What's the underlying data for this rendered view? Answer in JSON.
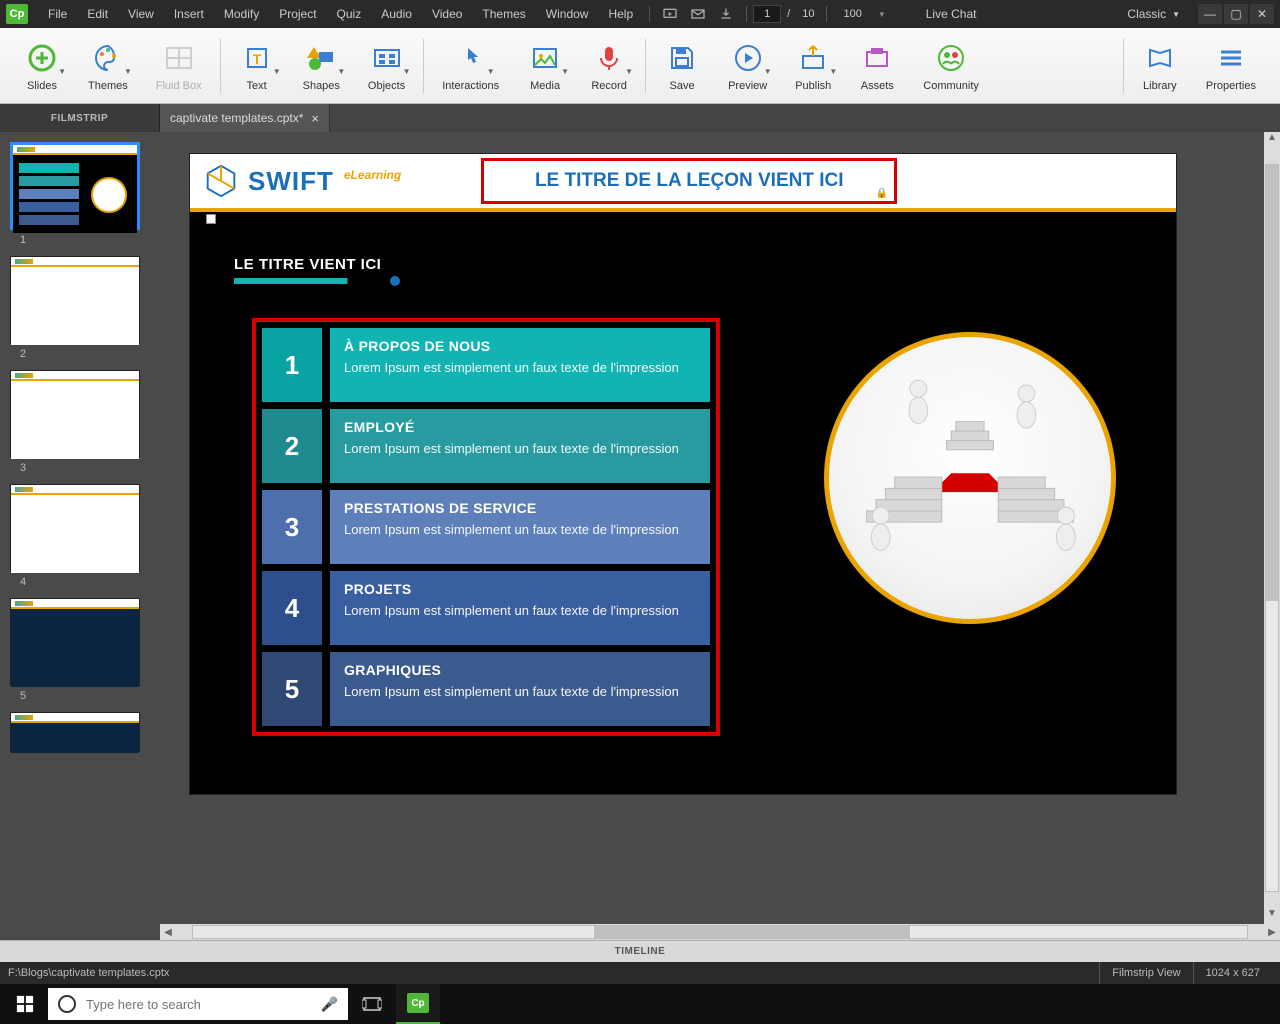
{
  "titlebar": {
    "menus": [
      "File",
      "Edit",
      "View",
      "Insert",
      "Modify",
      "Project",
      "Quiz",
      "Audio",
      "Video",
      "Themes",
      "Window",
      "Help"
    ],
    "page_current": "1",
    "page_total": "10",
    "zoom": "100",
    "live_chat": "Live Chat",
    "workspace": "Classic"
  },
  "ribbon": {
    "slides": "Slides",
    "themes": "Themes",
    "fluidbox": "Fluid Box",
    "text": "Text",
    "shapes": "Shapes",
    "objects": "Objects",
    "interactions": "Interactions",
    "media": "Media",
    "record": "Record",
    "save": "Save",
    "preview": "Preview",
    "publish": "Publish",
    "assets": "Assets",
    "community": "Community",
    "library": "Library",
    "properties": "Properties"
  },
  "filmstrip": {
    "label": "FILMSTRIP",
    "slide_numbers": [
      "1",
      "2",
      "3",
      "4",
      "5"
    ]
  },
  "tab": {
    "name": "captivate templates.cptx*"
  },
  "slide": {
    "logo_text": "SWIFT",
    "logo_sub": "eLearning",
    "lesson_title": "LE TITRE DE LA LEÇON VIENT ICI",
    "subtitle": "LE TITRE VIENT ICI",
    "items": [
      {
        "num": "1",
        "title": "À PROPOS DE NOUS",
        "desc": "Lorem Ipsum est simplement un faux texte de l'impression",
        "numColor": "#0aa3a3",
        "bodyColor": "#12b3b3"
      },
      {
        "num": "2",
        "title": "EMPLOYÉ",
        "desc": "Lorem Ipsum est simplement un faux texte de l'impression",
        "numColor": "#1f8a8f",
        "bodyColor": "#279b9f"
      },
      {
        "num": "3",
        "title": "PRESTATIONS DE SERVICE",
        "desc": "Lorem Ipsum est simplement un faux texte de l'impression",
        "numColor": "#4d6fae",
        "bodyColor": "#5d80bb"
      },
      {
        "num": "4",
        "title": "PROJETS",
        "desc": "Lorem Ipsum est simplement un faux texte de l'impression",
        "numColor": "#2d4f8d",
        "bodyColor": "#3a5fa0"
      },
      {
        "num": "5",
        "title": "GRAPHIQUES",
        "desc": "Lorem Ipsum est simplement un faux texte de l'impression",
        "numColor": "#304974",
        "bodyColor": "#3b5a8d"
      }
    ]
  },
  "timeline": {
    "label": "TIMELINE"
  },
  "status": {
    "path": "F:\\Blogs\\captivate templates.cptx",
    "view": "Filmstrip View",
    "dims": "1024 x 627"
  },
  "taskbar": {
    "search_placeholder": "Type here to search"
  }
}
